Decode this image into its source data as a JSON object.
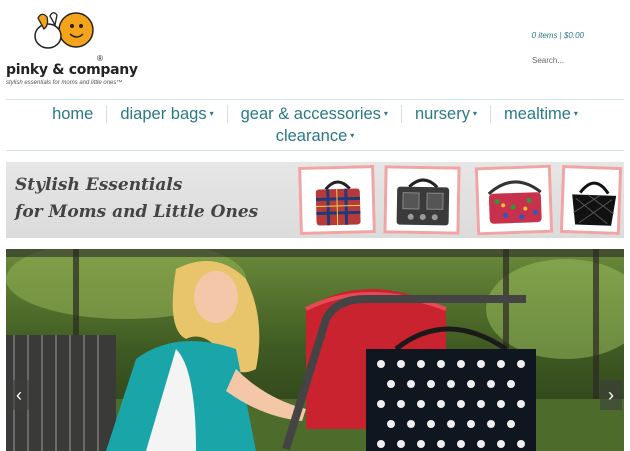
{
  "brand": {
    "name": "pinky & company",
    "registered": "®",
    "tagline": "stylish essentials for moms and little ones™"
  },
  "header": {
    "cart": "0 items | $0.00",
    "search_placeholder": "Search..."
  },
  "nav": {
    "row1": [
      {
        "label": "home",
        "caret": ""
      },
      {
        "label": "diaper bags",
        "caret": "▾"
      },
      {
        "label": "gear & accessories",
        "caret": "▾"
      },
      {
        "label": "nursery",
        "caret": "▾"
      },
      {
        "label": "mealtime",
        "caret": "▾"
      }
    ],
    "row2": [
      {
        "label": "clearance",
        "caret": "▾"
      }
    ]
  },
  "banner": {
    "line1": "Stylish Essentials",
    "line2": "for Moms and Little Ones"
  },
  "slider": {
    "prev": "‹",
    "next": "›"
  },
  "colors": {
    "nav_text": "#2a7a86",
    "logo_orange": "#f5a31a",
    "banner_border": "#f2a4a4"
  }
}
